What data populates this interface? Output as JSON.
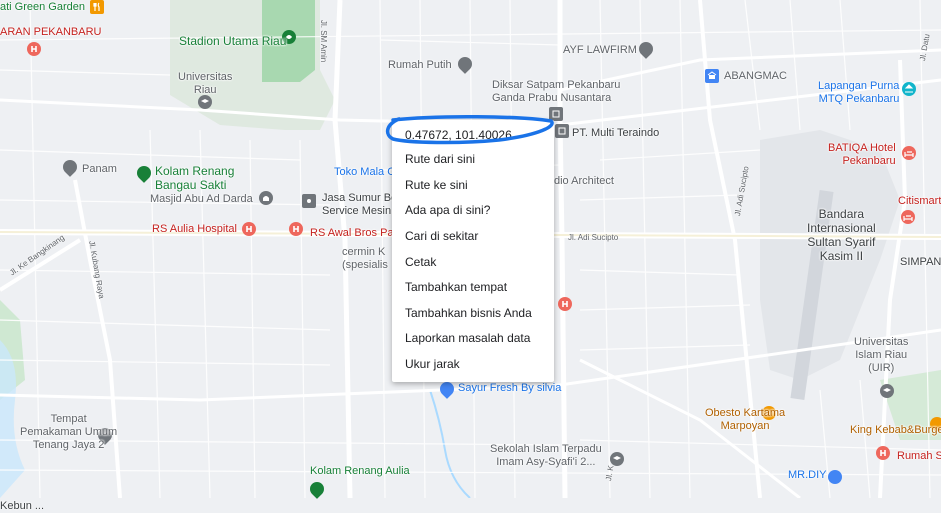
{
  "map": {
    "colors": {
      "land": "#eef0f3",
      "road": "#ffffff",
      "green": "#c8e6c9",
      "stadium": "#9ed3a6",
      "water": "#aadaff",
      "runway": "#dfe3e8"
    },
    "places": [
      {
        "key": "kebun",
        "name": "ati Green Garden",
        "cls": "green",
        "icon": "restaurant-icon"
      },
      {
        "key": "stadion",
        "name": "Stadion Utama Riau",
        "cls": "green",
        "icon": "stadium-icon"
      },
      {
        "key": "kebun_bandar",
        "name": "Kebun ...",
        "cls": "",
        "icon": ""
      },
      {
        "key": "rs_pekanbaru",
        "name": "ARAN PEKANBARU",
        "cls": "red",
        "icon": "hospital-icon"
      },
      {
        "key": "rumah_putih",
        "name": "Rumah Putih",
        "cls": "",
        "icon": "pin-icon"
      },
      {
        "key": "ayf",
        "name": "AYF LAWFIRM",
        "cls": "",
        "icon": "pin-icon"
      },
      {
        "key": "diksar",
        "name": "Diksar Satpam Pekanbaru\nGanda Prabu Nusantara",
        "cls": "",
        "icon": "pin-icon"
      },
      {
        "key": "abangmac",
        "name": "ABANGMAC",
        "cls": "",
        "icon": "shop-icon"
      },
      {
        "key": "lapangan",
        "name": "Lapangan Purna\nMTQ Pekanbaru",
        "cls": "blue",
        "icon": "landmark-icon"
      },
      {
        "key": "univ_riau",
        "name": "Universitas\nRiau",
        "cls": "",
        "icon": "school-icon"
      },
      {
        "key": "pt_multi",
        "name": "PT. Multi Teraindo",
        "cls": "",
        "icon": "building-icon"
      },
      {
        "key": "batiqa",
        "name": "BATIQA Hotel\nPekanbaru",
        "cls": "red",
        "icon": "hotel-icon"
      },
      {
        "key": "panam",
        "name": "Panam",
        "cls": "",
        "icon": "pin-icon"
      },
      {
        "key": "kolam_bangau",
        "name": "Kolam Renang\nBangau Sakti",
        "cls": "green",
        "icon": "pin-icon"
      },
      {
        "key": "toko_mala",
        "name": "Toko Mala C",
        "cls": "blue",
        "icon": ""
      },
      {
        "key": "radio",
        "name": "dio Architect",
        "cls": "",
        "icon": ""
      },
      {
        "key": "masjid",
        "name": "Masjid Abu Ad Darda",
        "cls": "",
        "icon": "mosque-icon"
      },
      {
        "key": "jasa",
        "name": "Jasa Sumur Bo\nService Mesin",
        "cls": "",
        "icon": "building-icon"
      },
      {
        "key": "citismart",
        "name": "Citismart",
        "cls": "red",
        "icon": "hotel-icon"
      },
      {
        "key": "bandara",
        "name": "Bandara\nInternasional\nSultan Syarif\nKasim II",
        "cls": "dark",
        "icon": ""
      },
      {
        "key": "rs_aulia",
        "name": "RS Aulia Hospital",
        "cls": "red",
        "icon": "hospital-icon"
      },
      {
        "key": "rs_awal",
        "name": "RS Awal Bros Pa",
        "cls": "red",
        "icon": "hospital-icon"
      },
      {
        "key": "cermin",
        "name": "cermin K\n(spesialis",
        "cls": "",
        "icon": ""
      },
      {
        "key": "simpang",
        "name": "SIMPANGT",
        "cls": "dark",
        "icon": ""
      },
      {
        "key": "uir",
        "name": "Universitas\nIslam Riau\n(UIR)",
        "cls": "",
        "icon": "school-icon"
      },
      {
        "key": "sayur",
        "name": "Sayur Fresh By silvia",
        "cls": "blue",
        "icon": "shop-icon"
      },
      {
        "key": "obesto",
        "name": "Obesto Kartama\nMarpoyan",
        "cls": "orange",
        "icon": "restaurant-icon"
      },
      {
        "key": "king",
        "name": "King Kebab&Burge",
        "cls": "orange",
        "icon": "restaurant-icon"
      },
      {
        "key": "pemakaman",
        "name": "Tempat\nPemakaman Umum\nTenang Jaya 2",
        "cls": "",
        "icon": "pin-icon"
      },
      {
        "key": "sekolah",
        "name": "Sekolah Islam Terpadu\nImam Asy-Syafi'i 2...",
        "cls": "",
        "icon": "school-icon"
      },
      {
        "key": "rumah_sakit_r",
        "name": "Rumah S",
        "cls": "red",
        "icon": "hospital-icon"
      },
      {
        "key": "mrdiy",
        "name": "MR.DIY",
        "cls": "blue",
        "icon": "shop-icon"
      },
      {
        "key": "kolam_aulia",
        "name": "Kolam Renang Aulia",
        "cls": "green",
        "icon": "pin-icon"
      }
    ],
    "roads": [
      {
        "key": "r1",
        "name": "Jl. SM Amin"
      },
      {
        "key": "r2",
        "name": "Jl. Ke Bangkinang"
      },
      {
        "key": "r3",
        "name": "Jl. Kubang Raya"
      },
      {
        "key": "r4",
        "name": "Jl. Adi Sucipto"
      },
      {
        "key": "r5",
        "name": "Jl. Adi Sucipto"
      },
      {
        "key": "r6",
        "name": "Jl. Datu"
      },
      {
        "key": "r7",
        "name": "Jl. K"
      }
    ]
  },
  "context_menu": {
    "coordinates": "0.47672, 101.40026",
    "items": [
      "Rute dari sini",
      "Rute ke sini",
      "Ada apa di sini?",
      "Cari di sekitar",
      "Cetak",
      "Tambahkan tempat",
      "Tambahkan bisnis Anda",
      "Laporkan masalah data",
      "Ukur jarak"
    ],
    "highlight_color": "#1a73e8"
  }
}
